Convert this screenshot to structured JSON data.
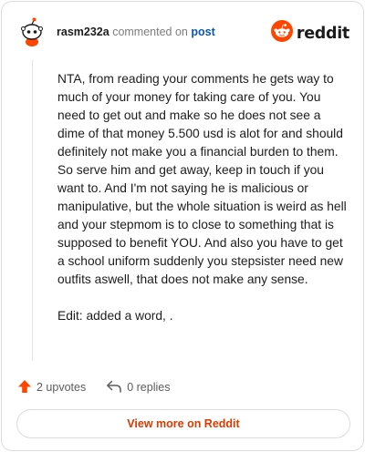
{
  "header": {
    "author": "rasm232a",
    "commented_on": "commented on",
    "post_link": "post",
    "brand": "reddit"
  },
  "comment": {
    "paragraphs": [
      "NTA, from reading your comments he gets way to much of your money for taking care of you. You need to get out and make so he does not see a dime of that money 5.500 usd is alot for and should definitely not make you a financial burden to them. So serve him and get away, keep in touch if you want to. And I'm not saying he is malicious or manipulative, but the whole situation is weird as hell and your stepmom is to close to something that is supposed to benefit YOU. And also you have to get a school uniform suddenly you stepsister need new outfits aswell, that does not make any sense.",
      "Edit: added a word, ."
    ]
  },
  "actions": {
    "upvotes": "2 upvotes",
    "replies": "0 replies"
  },
  "footer": {
    "view_more": "View more on Reddit"
  },
  "colors": {
    "accent": "#ff4500",
    "link": "#0a59a8",
    "view_more": "#d93a00"
  },
  "icons": [
    "reddit-avatar-icon",
    "reddit-logo-icon",
    "upvote-arrow-icon",
    "reply-arrow-icon"
  ]
}
